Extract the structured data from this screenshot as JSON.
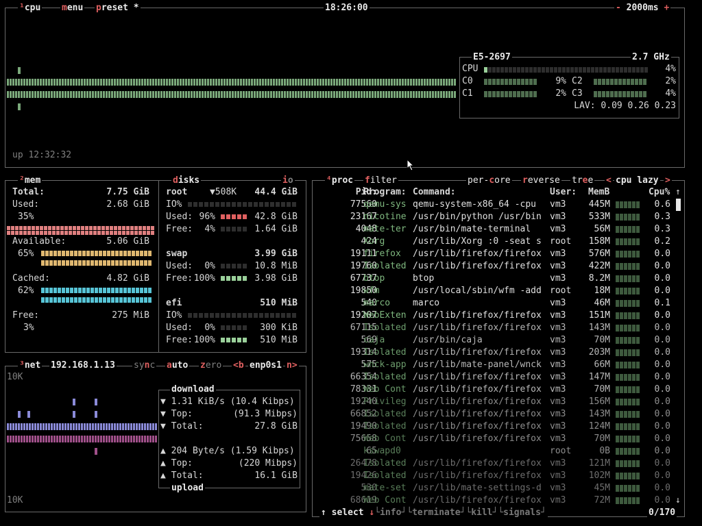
{
  "cpu_box": {
    "hk": "¹",
    "title": "cpu",
    "menu": "menu",
    "preset": "preset",
    "preset_mark": "*",
    "clock": "18:26:00",
    "minus": "-",
    "interval": "2000ms",
    "plus": "+",
    "uptime": "up 12:32:32",
    "model": "E5-2697",
    "freq": "2.7 GHz",
    "cpu_label": "CPU",
    "cpu_pct": "4%",
    "cores": [
      {
        "name": "C0",
        "pct": "9%"
      },
      {
        "name": "C1",
        "pct": "2%"
      },
      {
        "name": "C2",
        "pct": "2%"
      },
      {
        "name": "C3",
        "pct": "4%"
      }
    ],
    "lav": "LAV: 0.09 0.26 0.23"
  },
  "mem_box": {
    "hk": "²",
    "title": "mem",
    "total_label": "Total:",
    "total": "7.75 GiB",
    "used_label": "Used:",
    "used": "2.68 GiB",
    "used_pct": "35%",
    "available_label": "Available:",
    "available": "5.06 GiB",
    "available_pct": "65%",
    "cached_label": "Cached:",
    "cached": "4.82 GiB",
    "cached_pct": "62%",
    "free_label": "Free:",
    "free": "275 MiB",
    "free_pct": "3%",
    "colors": {
      "used": "#e08080",
      "available": "#e0b870",
      "cached": "#57c4d6"
    }
  },
  "disks_box": {
    "title": "disks",
    "io_label": "io",
    "disks": [
      {
        "name": "root",
        "speed": "▼508K",
        "size": "44.4 GiB",
        "io": "IO%",
        "used_label": "Used:",
        "used_pct": "96%",
        "used": "42.8 GiB",
        "free_label": "Free:",
        "free_pct": "4%",
        "free": "1.64 GiB"
      },
      {
        "name": "swap",
        "size": "3.99 GiB",
        "used_label": "Used:",
        "used_pct": "0%",
        "used": "10.8 MiB",
        "free_label": "Free:",
        "free_pct": "100%",
        "free": "3.98 GiB"
      },
      {
        "name": "efi",
        "size": "510 MiB",
        "io": "IO%",
        "used_label": "Used:",
        "used_pct": "0%",
        "used": "300 KiB",
        "free_label": "Free:",
        "free_pct": "100%",
        "free": "510 MiB"
      }
    ]
  },
  "net_box": {
    "hk": "³",
    "title": "net",
    "ip": "192.168.1.13",
    "sync": "sync",
    "auto": "auto",
    "zero": "zero",
    "prev": "<b",
    "iface": "enp0s1",
    "next": "n>",
    "scale_top": "10K",
    "scale_bottom": "10K",
    "download_title": "download",
    "upload_title": "upload",
    "down": {
      "rate": "1.31 KiB/s",
      "rate_bits": "(10.4 Kibps)",
      "top_label": "Top:",
      "top": "(91.3 Mibps)",
      "total_label": "Total:",
      "total": "27.8 GiB"
    },
    "up": {
      "rate": "204 Byte/s",
      "rate_bits": "(1.59 Kibps)",
      "top_label": "Top:",
      "top": "(220 Mibps)",
      "total_label": "Total:",
      "total": "16.1 GiB"
    }
  },
  "proc_box": {
    "hk": "⁴",
    "title": "proc",
    "filter": "filter",
    "per_core": "per-core",
    "reverse": "reverse",
    "tree": "tree",
    "sort_left": "<",
    "sort": "cpu lazy",
    "sort_right": ">",
    "headers": {
      "pid": "Pid:",
      "program": "Program:",
      "command": "Command:",
      "user": "User:",
      "mem": "MemB",
      "cpu": "Cpu%"
    },
    "rows": [
      {
        "pid": "77560",
        "program": "qemu-sys",
        "command": "qemu-system-x86_64 -cpu",
        "user": "vm3",
        "mem": "445M",
        "cpu": "0.6"
      },
      {
        "pid": "23167",
        "program": "nicotine",
        "command": "/usr/bin/python /usr/bin",
        "user": "vm3",
        "mem": "533M",
        "cpu": "0.3"
      },
      {
        "pid": "4048",
        "program": "mate-ter",
        "command": "/usr/bin/mate-terminal",
        "user": "vm3",
        "mem": "56M",
        "cpu": "0.3"
      },
      {
        "pid": "424",
        "program": "Xorg",
        "command": "/usr/lib/Xorg :0 -seat s",
        "user": "root",
        "mem": "158M",
        "cpu": "0.2"
      },
      {
        "pid": "19111",
        "program": "firefox",
        "command": "/usr/lib/firefox/firefox",
        "user": "vm3",
        "mem": "576M",
        "cpu": "0.0"
      },
      {
        "pid": "19760",
        "program": "Isolated",
        "command": "/usr/lib/firefox/firefox",
        "user": "vm3",
        "mem": "422M",
        "cpu": "0.0"
      },
      {
        "pid": "67737",
        "program": "btop",
        "command": "btop",
        "user": "vm3",
        "mem": "8.2M",
        "cpu": "0.0"
      },
      {
        "pid": "19850",
        "program": "wfm",
        "command": "/usr/local/sbin/wfm -add",
        "user": "root",
        "mem": "18M",
        "cpu": "0.0"
      },
      {
        "pid": "540",
        "program": "marco",
        "command": "marco",
        "user": "vm3",
        "mem": "46M",
        "cpu": "0.1"
      },
      {
        "pid": "19207",
        "program": "WebExten",
        "command": "/usr/lib/firefox/firefox",
        "user": "vm3",
        "mem": "151M",
        "cpu": "0.0"
      },
      {
        "pid": "67115",
        "program": "Isolated",
        "command": "/usr/lib/firefox/firefox",
        "user": "vm3",
        "mem": "143M",
        "cpu": "0.0"
      },
      {
        "pid": "569",
        "program": "caja",
        "command": "/usr/bin/caja",
        "user": "vm3",
        "mem": "70M",
        "cpu": "0.0"
      },
      {
        "pid": "19314",
        "program": "Isolated",
        "command": "/usr/lib/firefox/firefox",
        "user": "vm3",
        "mem": "203M",
        "cpu": "0.0"
      },
      {
        "pid": "575",
        "program": "wnck-app",
        "command": "/usr/lib/mate-panel/wnck",
        "user": "vm3",
        "mem": "66M",
        "cpu": "0.0"
      },
      {
        "pid": "66354",
        "program": "Isolated",
        "command": "/usr/lib/firefox/firefox",
        "user": "vm3",
        "mem": "147M",
        "cpu": "0.0"
      },
      {
        "pid": "78331",
        "program": "Web Cont",
        "command": "/usr/lib/firefox/firefox",
        "user": "vm3",
        "mem": "70M",
        "cpu": "0.0"
      },
      {
        "pid": "19240",
        "program": "Privileg",
        "command": "/usr/lib/firefox/firefox",
        "user": "vm3",
        "mem": "156M",
        "cpu": "0.0"
      },
      {
        "pid": "66852",
        "program": "Isolated",
        "command": "/usr/lib/firefox/firefox",
        "user": "vm3",
        "mem": "143M",
        "cpu": "0.0"
      },
      {
        "pid": "19490",
        "program": "Isolated",
        "command": "/usr/lib/firefox/firefox",
        "user": "vm3",
        "mem": "124M",
        "cpu": "0.0"
      },
      {
        "pid": "75658",
        "program": "Web Cont",
        "command": "/usr/lib/firefox/firefox",
        "user": "vm3",
        "mem": "70M",
        "cpu": "0.0"
      },
      {
        "pid": "65",
        "program": "kswapd0",
        "command": "",
        "user": "root",
        "mem": "0B",
        "cpu": "0.0"
      },
      {
        "pid": "26478",
        "program": "Isolated",
        "command": "/usr/lib/firefox/firefox",
        "user": "vm3",
        "mem": "121M",
        "cpu": "0.0"
      },
      {
        "pid": "19426",
        "program": "Isolated",
        "command": "/usr/lib/firefox/firefox",
        "user": "vm3",
        "mem": "102M",
        "cpu": "0.0"
      },
      {
        "pid": "530",
        "program": "mate-set",
        "command": "/usr/lib/mate-settings-d",
        "user": "vm3",
        "mem": "45M",
        "cpu": "0.0"
      },
      {
        "pid": "68619",
        "program": "Web Cont",
        "command": "/usr/lib/firefox/firefox",
        "user": "vm3",
        "mem": "72M",
        "cpu": "0.0"
      }
    ],
    "footer": {
      "up": "↑",
      "select": "select",
      "down": "↓",
      "info": "info",
      "terminate": "terminate",
      "kill": "kill",
      "signals": "signals",
      "count": "0/170"
    },
    "scroll_up": "↑",
    "scroll_down": "↓"
  }
}
